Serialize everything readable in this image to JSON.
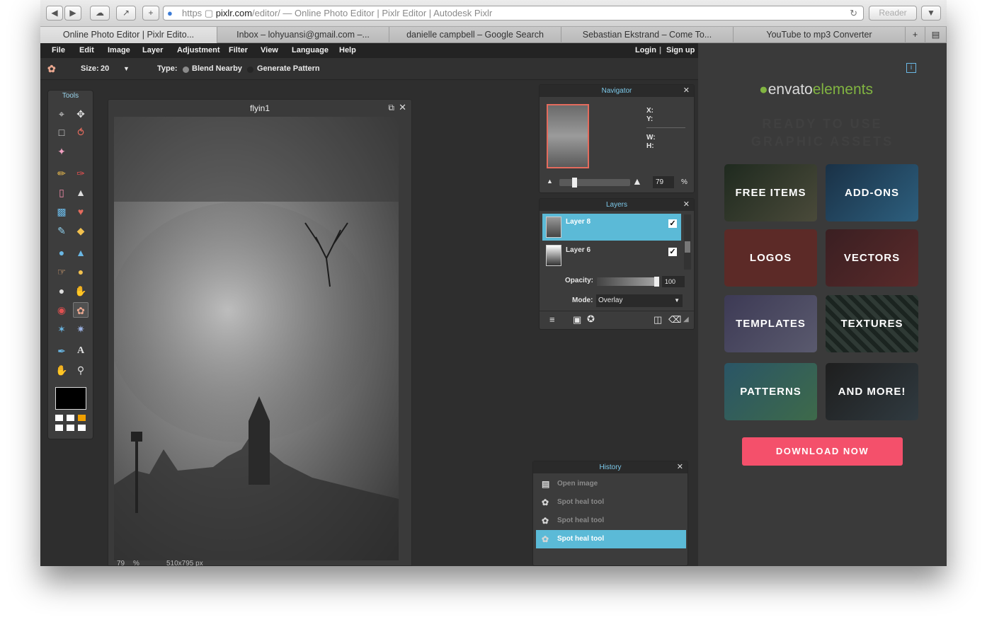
{
  "browser": {
    "url_scheme": "https",
    "url_host": "pixlr.com",
    "url_path": "/editor/",
    "page_title_suffix": " — Online Photo Editor | Pixlr Editor | Autodesk Pixlr",
    "reader_label": "Reader",
    "tabs": [
      {
        "label": "Online Photo Editor | Pixlr Edito..."
      },
      {
        "label": "Inbox – lohyuansi@gmail.com –..."
      },
      {
        "label": "danielle campbell – Google Search"
      },
      {
        "label": "Sebastian Ekstrand – Come To..."
      },
      {
        "label": "YouTube to mp3 Converter"
      }
    ]
  },
  "menu": {
    "items": [
      "File",
      "Edit",
      "Image",
      "Layer",
      "Adjustment",
      "Filter",
      "View",
      "Language",
      "Help"
    ],
    "login": "Login",
    "separator": "|",
    "signup": "Sign up"
  },
  "options": {
    "size_label": "Size:",
    "size_value": "20",
    "type_label": "Type:",
    "type_option_1": "Blend Nearby",
    "type_option_2": "Generate Pattern"
  },
  "tools": {
    "title": "Tools"
  },
  "document": {
    "title": "flyin1",
    "zoom": "79",
    "zoom_unit": "%",
    "dimensions": "510x795 px"
  },
  "navigator": {
    "title": "Navigator",
    "x_label": "X:",
    "y_label": "Y:",
    "w_label": "W:",
    "h_label": "H:",
    "zoom_value": "79",
    "zoom_unit": "%"
  },
  "layers": {
    "title": "Layers",
    "items": [
      {
        "name": "Layer 8"
      },
      {
        "name": "Layer 6"
      }
    ],
    "opacity_label": "Opacity:",
    "opacity_value": "100",
    "mode_label": "Mode:",
    "mode_value": "Overlay"
  },
  "history": {
    "title": "History",
    "items": [
      "Open image",
      "Spot heal tool",
      "Spot heal tool",
      "Spot heal tool"
    ]
  },
  "ad": {
    "brand_1": "envato",
    "brand_2": "elements",
    "tagline_1": "READY TO USE",
    "tagline_2": "GRAPHIC ASSETS",
    "tiles": [
      "FREE ITEMS",
      "ADD-ONS",
      "LOGOS",
      "VECTORS",
      "TEMPLATES",
      "TEXTURES",
      "PATTERNS",
      "AND MORE!"
    ],
    "cta": "DOWNLOAD NOW"
  },
  "colors": {
    "accent": "#5bbad7",
    "cta": "#f4506b",
    "brand_green": "#81b441"
  }
}
